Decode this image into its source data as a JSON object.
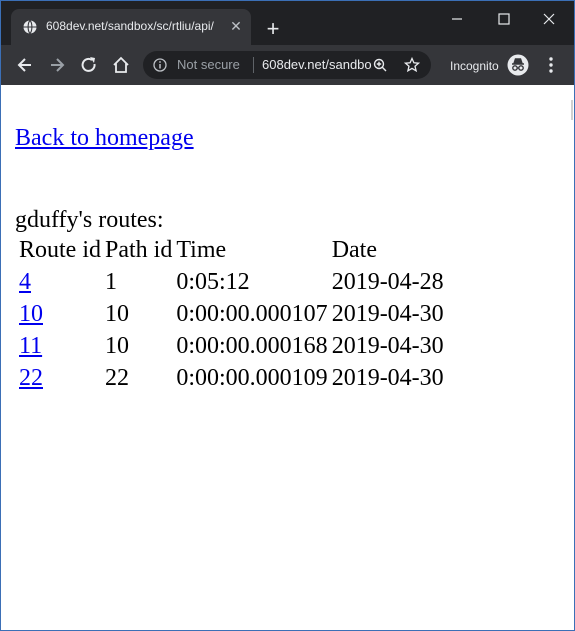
{
  "browser": {
    "tab_title": "608dev.net/sandbox/sc/rtliu/api/",
    "security_label": "Not secure",
    "url": "608dev.net/sandbox/sc/rtliu/api/",
    "mode_label": "Incognito",
    "icons": [
      "globe-icon",
      "close-icon",
      "plus-icon",
      "minimize-icon",
      "maximize-icon",
      "window-close-icon",
      "back-arrow-icon",
      "forward-arrow-icon",
      "reload-icon",
      "home-icon",
      "info-icon",
      "zoom-icon",
      "star-icon",
      "incognito-icon",
      "kebab-menu-icon"
    ]
  },
  "page": {
    "back_link": "Back to homepage",
    "owner_heading": "gduffy's routes:",
    "columns": [
      "Route id",
      "Path id",
      "Time",
      "Date"
    ],
    "rows": [
      {
        "route_id": "4",
        "path_id": "1",
        "time": "0:05:12",
        "date": "2019-04-28"
      },
      {
        "route_id": "10",
        "path_id": "10",
        "time": "0:00:00.000107",
        "date": "2019-04-30"
      },
      {
        "route_id": "11",
        "path_id": "10",
        "time": "0:00:00.000168",
        "date": "2019-04-30"
      },
      {
        "route_id": "22",
        "path_id": "22",
        "time": "0:00:00.000109",
        "date": "2019-04-30"
      }
    ]
  },
  "colors": {
    "titlebar": "#202124",
    "toolbar": "#35363a",
    "link": "#0000ee"
  }
}
